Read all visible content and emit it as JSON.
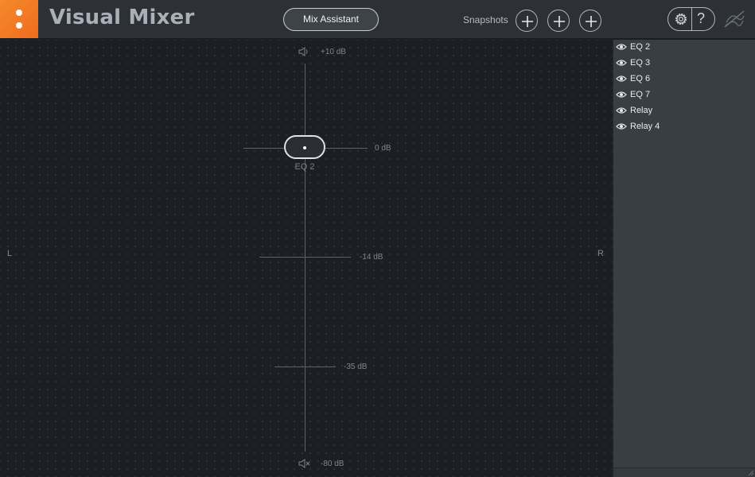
{
  "header": {
    "title": "Visual Mixer",
    "mix_assistant_label": "Mix Assistant",
    "snapshots_label": "Snapshots",
    "help_symbol": "?"
  },
  "mixer": {
    "left_label": "L",
    "right_label": "R",
    "db_marks": [
      "+10 dB",
      "0 dB",
      "-14 dB",
      "-35 dB",
      "-80 dB"
    ],
    "selected_track": {
      "label": "EQ 2",
      "gain_db": 0,
      "pan": 0
    }
  },
  "tracks": [
    {
      "name": "EQ 2",
      "visible": true
    },
    {
      "name": "EQ 3",
      "visible": true
    },
    {
      "name": "EQ 6",
      "visible": true
    },
    {
      "name": "EQ 7",
      "visible": true
    },
    {
      "name": "Relay",
      "visible": true
    },
    {
      "name": "Relay 4",
      "visible": true
    }
  ],
  "colors": {
    "accent": "#f07a26",
    "background": "#1b1e22",
    "panel": "#393e44"
  },
  "icons": {
    "menu": "menu-dots-icon",
    "snapshot_add": "plus-icon",
    "settings": "gear-icon",
    "help": "help-icon",
    "brand": "ozone-logo-icon",
    "mute_top": "speaker-icon",
    "mute_bottom": "speaker-muted-icon",
    "visibility": "eye-icon"
  }
}
